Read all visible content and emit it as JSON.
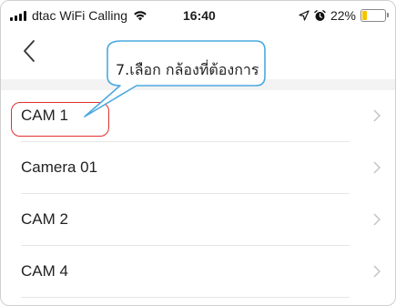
{
  "status_bar": {
    "carrier": "dtac WiFi Calling",
    "time": "16:40",
    "battery_text": "22%",
    "battery_level": 0.22,
    "battery_color": "#f5c400"
  },
  "nav": {
    "back_icon": "chevron-left-icon"
  },
  "camera_list": {
    "items": [
      {
        "label": "CAM 1"
      },
      {
        "label": "Camera 01"
      },
      {
        "label": "CAM 2"
      },
      {
        "label": "CAM 4"
      }
    ],
    "item_icon": "chevron-right-icon"
  },
  "annotation": {
    "callout_text": "7.เลือก กล้องที่ต้องการ",
    "callout_color": "#4aa8e0",
    "highlight_color": "#e0312f"
  }
}
